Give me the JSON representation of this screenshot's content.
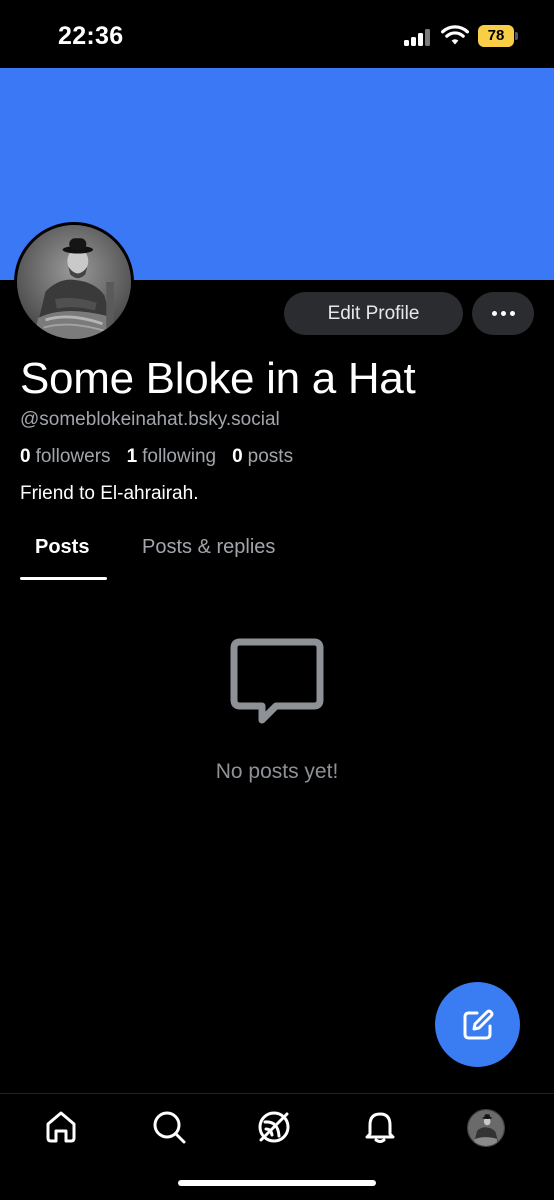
{
  "status_bar": {
    "time": "22:36",
    "battery": "78"
  },
  "colors": {
    "banner": "#3a78f5",
    "accent": "#3a7cf2",
    "battery": "#f7ce46"
  },
  "profile": {
    "display_name": "Some Bloke in a Hat",
    "handle": "@someblokeinahat.bsky.social",
    "bio": "Friend to El-ahrairah.",
    "stats": {
      "followers_count": "0",
      "followers_label": "followers",
      "following_count": "1",
      "following_label": "following",
      "posts_count": "0",
      "posts_label": "posts"
    }
  },
  "actions": {
    "edit_profile_label": "Edit Profile",
    "more_icon": "ellipsis-icon"
  },
  "tabs": [
    {
      "label": "Posts",
      "active": true
    },
    {
      "label": "Posts & replies",
      "active": false
    }
  ],
  "empty_state": {
    "icon": "message-bubble-icon",
    "text": "No posts yet!"
  },
  "fab": {
    "icon": "compose-icon"
  },
  "bottom_nav": {
    "items": [
      "home-icon",
      "search-icon",
      "feeds-icon",
      "notifications-icon",
      "profile-avatar"
    ]
  }
}
